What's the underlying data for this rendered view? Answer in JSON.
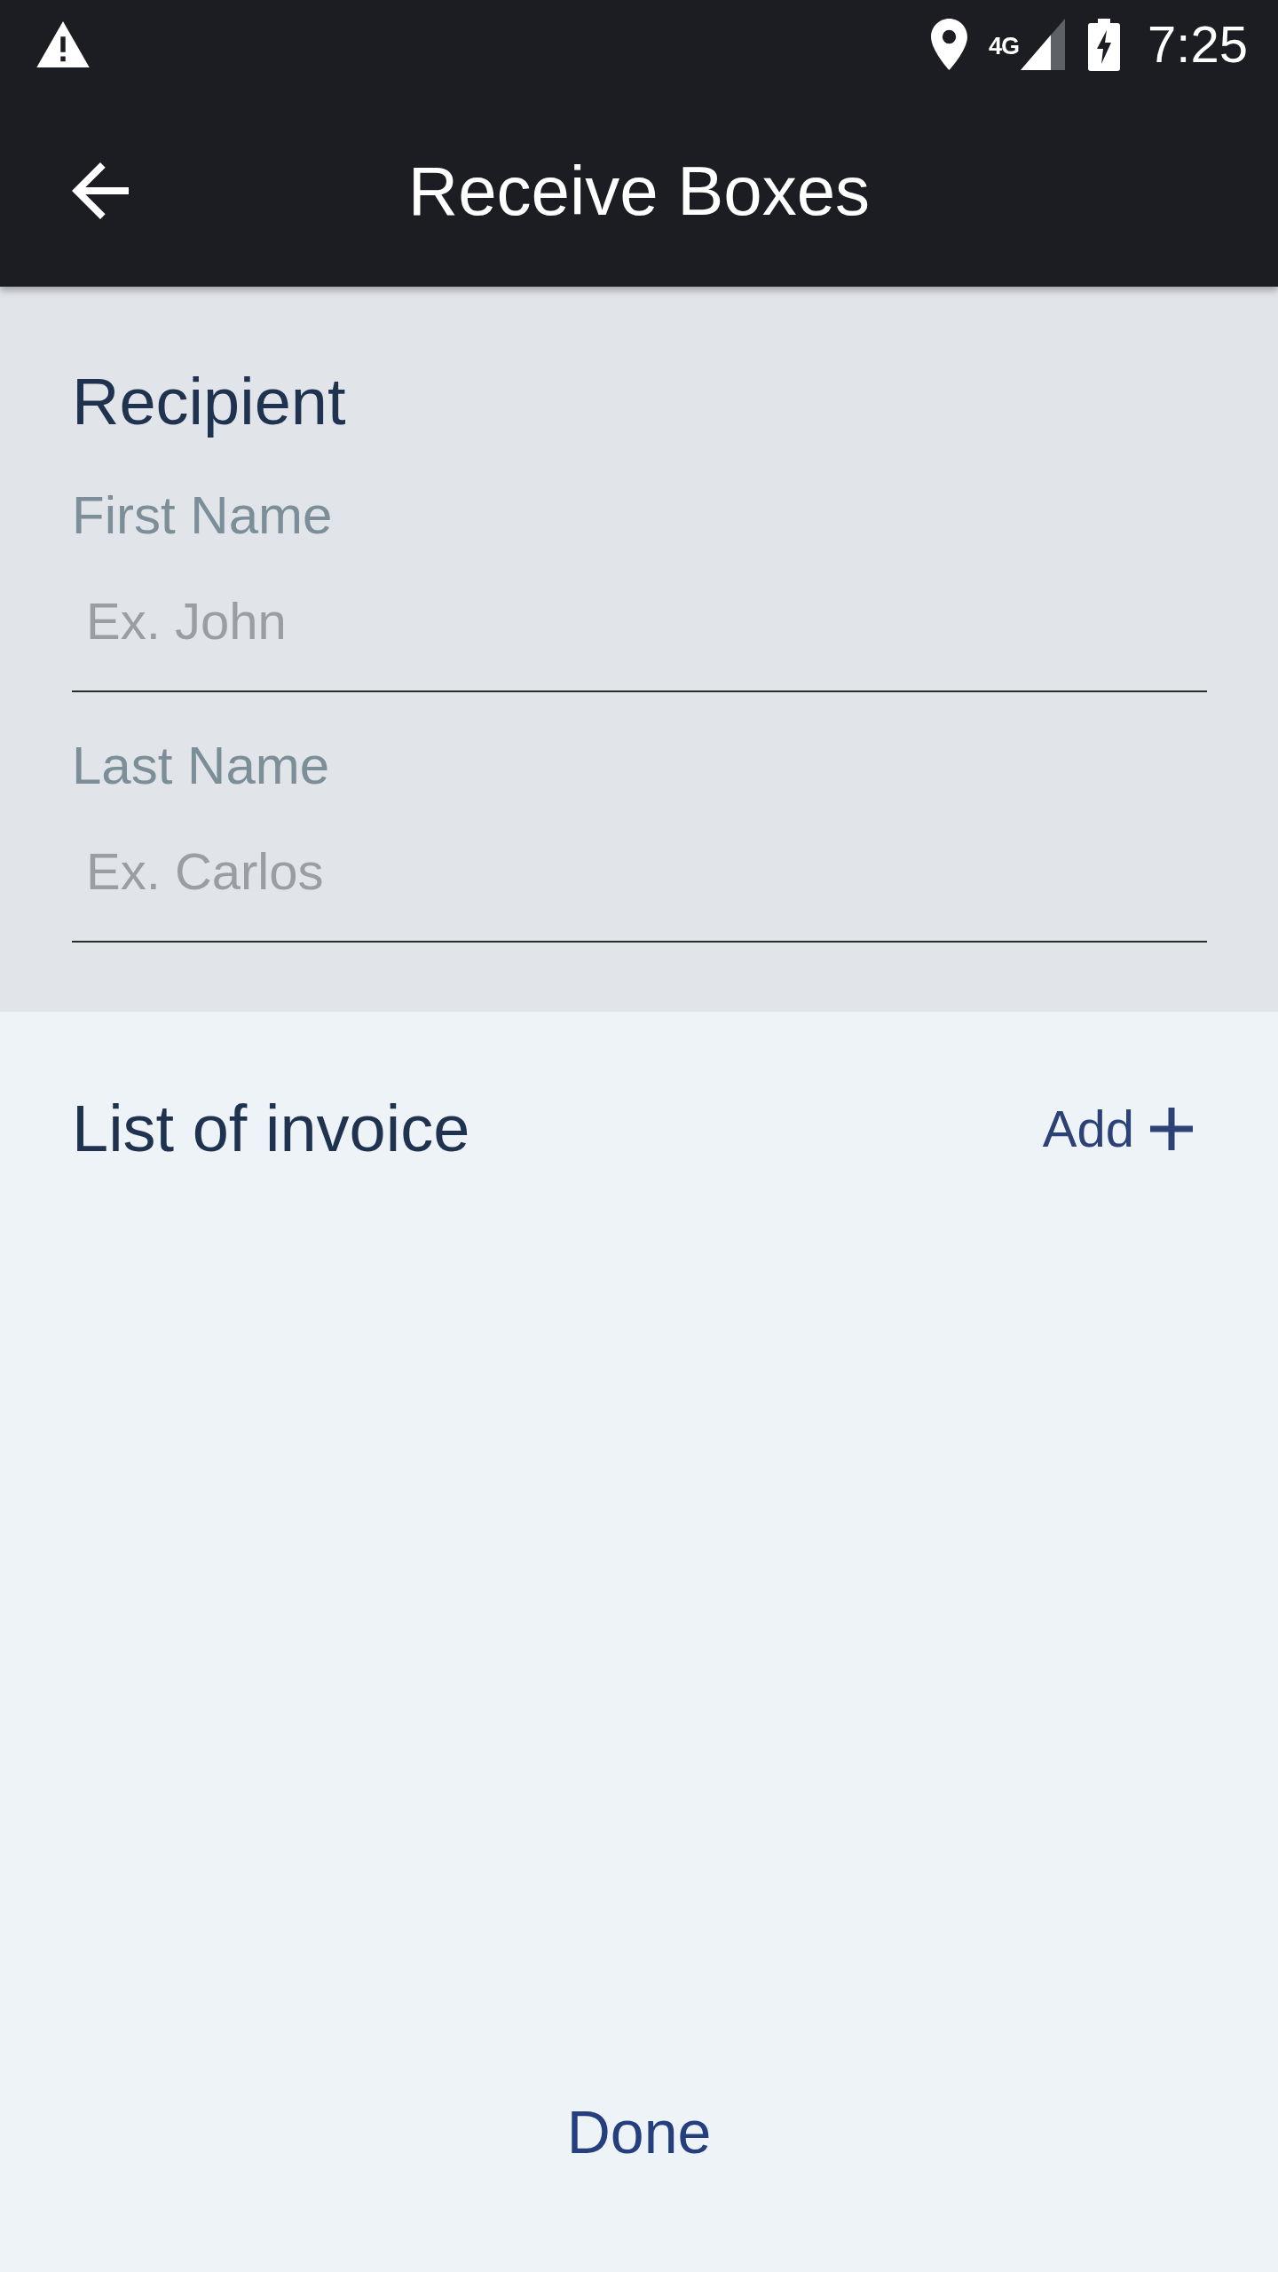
{
  "status_bar": {
    "network": "4G",
    "time": "7:25"
  },
  "app_bar": {
    "title": "Receive Boxes"
  },
  "recipient": {
    "heading": "Recipient",
    "fields": [
      {
        "label": "First Name",
        "placeholder": "Ex. John"
      },
      {
        "label": "Last Name",
        "placeholder": "Ex. Carlos"
      }
    ]
  },
  "invoices": {
    "heading": "List of invoice",
    "add_button": "Add"
  },
  "done_button": "Done"
}
